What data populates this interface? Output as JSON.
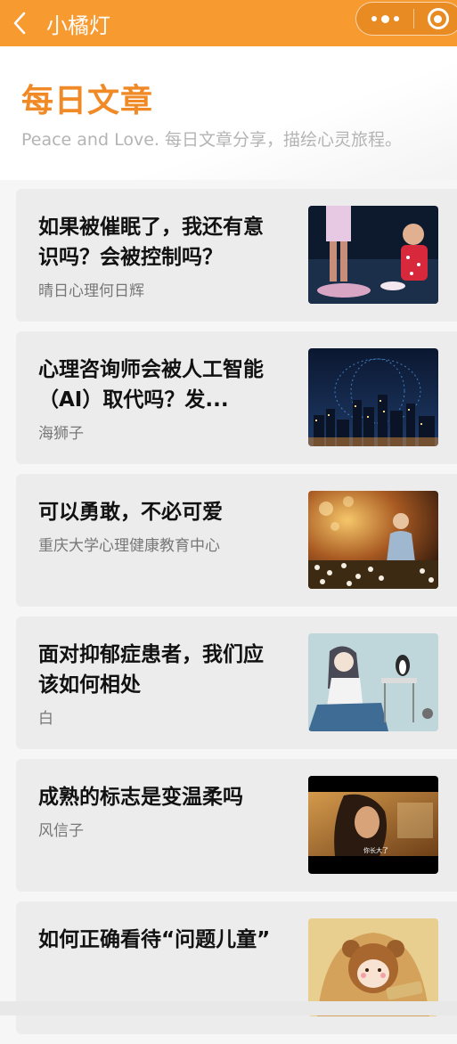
{
  "navbar": {
    "title": "小橘灯",
    "back_icon": "chevron-left-icon",
    "more_icon": "more-dots-icon",
    "close_icon": "target-close-icon",
    "background": "#f79a2f"
  },
  "header": {
    "title": "每日文章",
    "subtitle": "Peace and Love. 每日文章分享，描绘心灵旅程。",
    "accent": "#f08a27"
  },
  "articles": [
    {
      "title": "如果被催眠了，我还有意识吗？会被控制吗？",
      "author": "晴日心理何日辉",
      "thumb": "girl-at-night-photo"
    },
    {
      "title": "心理咨询师会被人工智能（AI）取代吗？发...",
      "author": "海狮子",
      "thumb": "city-night-skyline-photo"
    },
    {
      "title": "可以勇敢，不必可爱",
      "author": "重庆大学心理健康教育中心",
      "thumb": "girl-in-dandelion-field-photo"
    },
    {
      "title": "面对抑郁症患者，我们应该如何相处",
      "author": "白",
      "thumb": "girl-and-penguin-illustration"
    },
    {
      "title": "成熟的标志是变温柔吗",
      "author": "风信子",
      "thumb": "film-still-photo"
    },
    {
      "title": "如何正确看待“问题儿童”",
      "author": "",
      "thumb": "bear-cartoon-illustration"
    }
  ],
  "thumb_captions": {
    "film_subtitle": "你长大了"
  }
}
